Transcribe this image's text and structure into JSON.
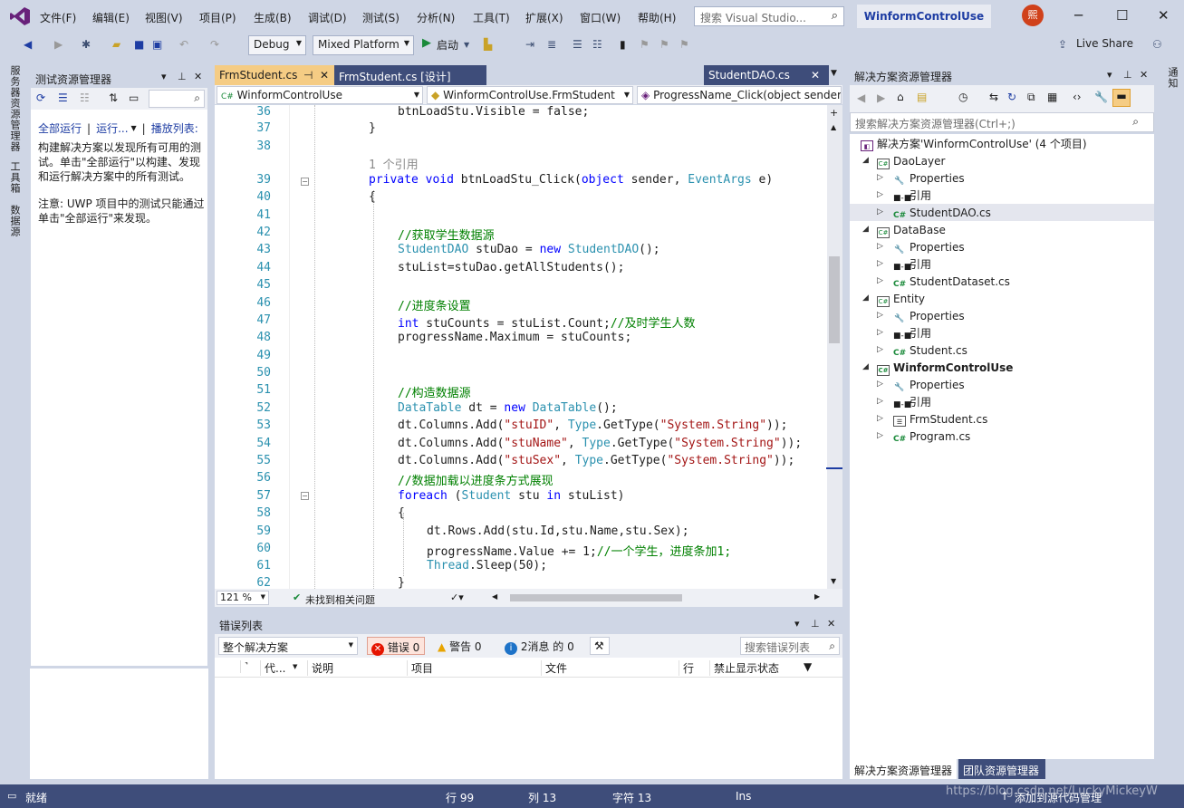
{
  "menu": [
    "文件(F)",
    "编辑(E)",
    "视图(V)",
    "项目(P)",
    "生成(B)",
    "调试(D)",
    "测试(S)",
    "分析(N)",
    "工具(T)",
    "扩展(X)",
    "窗口(W)",
    "帮助(H)"
  ],
  "search_placeholder": "搜索 Visual Studio...",
  "project_name": "WinformControlUse",
  "avatar_text": "熙",
  "toolbar": {
    "config": "Debug",
    "platform": "Mixed Platform",
    "start": "启动",
    "live_share": "Live Share"
  },
  "left_strip": [
    "服务器资源管理器",
    "工具箱",
    "数据源"
  ],
  "test_explorer": {
    "title": "测试资源管理器",
    "run_all": "全部运行",
    "run": "运行...",
    "playlist": "播放列表:",
    "desc": "构建解决方案以发现所有可用的测试。单击\"全部运行\"以构建、发现和运行解决方案中的所有测试。",
    "note": "注意: UWP 项目中的测试只能通过单击\"全部运行\"来发现。"
  },
  "doc_tabs": {
    "active": "FrmStudent.cs",
    "second": "FrmStudent.cs [设计]",
    "right": "StudentDAO.cs"
  },
  "nav": {
    "project": "WinformControlUse",
    "class": "WinformControlUse.FrmStudent",
    "member": "ProgressName_Click(object sender"
  },
  "code": {
    "line_numbers": [
      "36",
      "37",
      "38",
      "",
      "39",
      "40",
      "41",
      "42",
      "43",
      "44",
      "45",
      "46",
      "47",
      "48",
      "49",
      "50",
      "51",
      "52",
      "53",
      "54",
      "55",
      "56",
      "57",
      "58",
      "59",
      "60",
      "61",
      "62"
    ],
    "l36": "btnLoadStu.Visible = false;",
    "l37": "}",
    "ref": "1 个引用",
    "l39_kw1": "private",
    "l39_kw2": "void",
    "l39_name": " btnLoadStu_Click(",
    "l39_kw3": "object",
    "l39_a": " sender, ",
    "l39_ty": "EventArgs",
    "l39_b": " e)",
    "l40": "{",
    "l42": "//获取学生数据源",
    "l43_ty1": "StudentDAO",
    "l43_a": " stuDao = ",
    "l43_kw": "new",
    "l43_ty2": "StudentDAO",
    "l43_b": "();",
    "l44": "stuList=stuDao.getAllStudents();",
    "l46": "//进度条设置",
    "l47_kw": "int",
    "l47_a": " stuCounts = stuList.Count;",
    "l47_cm": "//及时学生人数",
    "l48": "progressName.Maximum = stuCounts;",
    "l51": "//构造数据源",
    "l52_ty1": "DataTable",
    "l52_a": " dt = ",
    "l52_kw": "new",
    "l52_ty2": "DataTable",
    "l52_b": "();",
    "l53_a": "dt.Columns.Add(",
    "l53_s1": "\"stuID\"",
    "l53_b": ", ",
    "l53_ty": "Type",
    "l53_c": ".GetType(",
    "l53_s2": "\"System.String\"",
    "l53_d": "));",
    "l54_s1": "\"stuName\"",
    "l55_s1": "\"stuSex\"",
    "l56": "//数据加载以进度条方式展现",
    "l57_kw": "foreach",
    "l57_a": " (",
    "l57_ty": "Student",
    "l57_b": " stu ",
    "l57_kw2": "in",
    "l57_c": " stuList)",
    "l58": "{",
    "l59": "dt.Rows.Add(stu.Id,stu.Name,stu.Sex);",
    "l60_a": "progressName.Value += 1;",
    "l60_cm": "//一个学生，进度条加1;",
    "l61_ty": "Thread",
    "l61_a": ".Sleep(50);",
    "l62": "}"
  },
  "editor_status": {
    "zoom": "121 %",
    "issues": "未找到相关问题"
  },
  "error_list": {
    "title": "错误列表",
    "scope": "整个解决方案",
    "errors": "错误 0",
    "warnings": "警告 0",
    "messages": "2消息 的 0",
    "search": "搜索错误列表",
    "columns": [
      "代...",
      "说明",
      "项目",
      "文件",
      "行",
      "禁止显示状态"
    ]
  },
  "solution": {
    "title": "解决方案资源管理器",
    "search": "搜索解决方案资源管理器(Ctrl+;)",
    "root": "解决方案'WinformControlUse' (4 个项目)",
    "items": [
      "DaoLayer",
      "Properties",
      "引用",
      "StudentDAO.cs",
      "DataBase",
      "Properties",
      "引用",
      "StudentDataset.cs",
      "Entity",
      "Properties",
      "引用",
      "Student.cs",
      "WinformControlUse",
      "Properties",
      "引用",
      "FrmStudent.cs",
      "Program.cs"
    ],
    "tabs": [
      "解决方案资源管理器",
      "团队资源管理器"
    ]
  },
  "right_strip": "通知",
  "status": {
    "ready": "就绪",
    "row": "行 99",
    "col": "列 13",
    "char": "字符 13",
    "ins": "Ins",
    "add_source": "添加到源代码管理",
    "watermark": "https://blog.csdn.net/LuckyMickeyW"
  },
  "colors": {
    "accent": "#1e3da3",
    "statusbar": "#3e4d7a",
    "keyword": "#0000ff",
    "type": "#2b91af",
    "comment": "#008000",
    "string": "#a31515"
  }
}
